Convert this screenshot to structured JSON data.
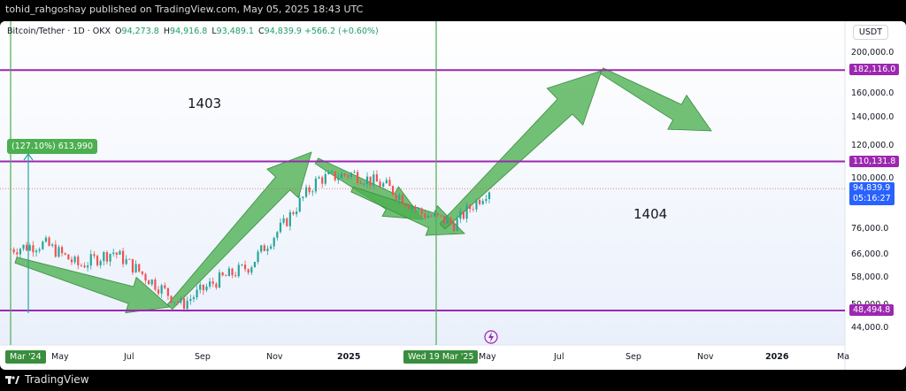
{
  "header": {
    "text": "tohid_rahgoshay published on TradingView.com, May 05, 2025 18:43 UTC"
  },
  "legend": {
    "symbol": "Bitcoin/Tether · 1D · OKX",
    "o_label": "O",
    "o_val": "94,273.8",
    "h_label": "H",
    "h_val": "94,916.8",
    "l_label": "L",
    "l_val": "93,489.1",
    "c_label": "C",
    "c_val": "94,839.9",
    "change": "+566.2 (+0.60%)"
  },
  "currency": "USDT",
  "footer": {
    "brand": "TradingView"
  },
  "colors": {
    "purple": "#9c27b0",
    "green": "#4caf50",
    "blue": "#2962ff",
    "candle_up": "#26a69a",
    "candle_down": "#ef5350"
  },
  "chart_data": {
    "type": "candlestick",
    "y_scale": "log",
    "ylim": [
      40000,
      240000
    ],
    "x_ticks": [
      "Mar '24",
      "May",
      "Jul",
      "Sep",
      "Nov",
      "2025",
      "Wed 19 Mar '25",
      "May",
      "Jul",
      "Sep",
      "Nov",
      "2026",
      "Ma"
    ],
    "y_ticks": [
      "200,000.0",
      "160,000.0",
      "140,000.0",
      "120,000.0",
      "100,000.0",
      "76,000.0",
      "66,000.0",
      "58,000.0",
      "50,000.0",
      "44,000.0"
    ],
    "horizontal_levels": [
      {
        "value": 182116.0,
        "label": "182,116.0"
      },
      {
        "value": 110131.8,
        "label": "110,131.8"
      },
      {
        "value": 48494.8,
        "label": "48,494.8"
      }
    ],
    "current_price": {
      "value": 94839.9,
      "label": "94,839.9",
      "countdown": "05:16:27"
    },
    "vertical_marker": {
      "label": "Wed 19 Mar '25"
    },
    "measure": {
      "label": "(127.10%) 613,990"
    },
    "annotations": [
      "1403",
      "1404"
    ],
    "price_path": [
      [
        "Mar '24",
        68000
      ],
      [
        "Apr",
        70000
      ],
      [
        "May",
        62000
      ],
      [
        "Jun",
        67000
      ],
      [
        "Jul",
        58000
      ],
      [
        "Aug",
        50000
      ],
      [
        "Sep",
        57000
      ],
      [
        "Oct",
        62000
      ],
      [
        "Nov",
        78000
      ],
      [
        "Dec",
        100000
      ],
      [
        "Jan",
        103000
      ],
      [
        "Feb",
        96000
      ],
      [
        "Mar",
        83000
      ],
      [
        "Apr",
        78000
      ],
      [
        "May",
        94839.9
      ]
    ]
  }
}
